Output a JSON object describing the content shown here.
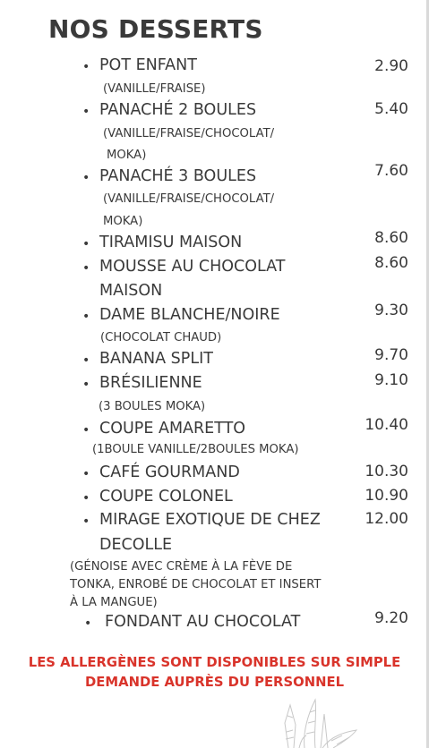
{
  "menu": {
    "title": "NOS DESSERTS",
    "bullet": "•",
    "items": [
      {
        "name": "POT ENFANT",
        "price": "2.90",
        "desc": [
          "(VANILLE/FRAISE)"
        ]
      },
      {
        "name": "PANACHÉ 2 BOULES",
        "price": "5.40",
        "desc": [
          "(VANILLE/FRAISE/CHOCOLAT/",
          "MOKA)"
        ]
      },
      {
        "name": "PANACHÉ 3 BOULES",
        "price": "7.60",
        "desc": [
          "(VANILLE/FRAISE/CHOCOLAT/",
          "MOKA)"
        ]
      },
      {
        "name": "TIRAMISU MAISON",
        "price": "8.60",
        "desc": []
      },
      {
        "name": "MOUSSE AU CHOCOLAT",
        "name2": "MAISON",
        "price": "8.60",
        "desc": []
      },
      {
        "name": "DAME BLANCHE/NOIRE",
        "price": "9.30",
        "desc": [
          "(CHOCOLAT CHAUD)"
        ]
      },
      {
        "name": "BANANA SPLIT",
        "price": "9.70",
        "desc": []
      },
      {
        "name": "BRÉSILIENNE",
        "price": "9.10",
        "desc": [
          "(3 BOULES MOKA)"
        ]
      },
      {
        "name": "COUPE AMARETTO",
        "price": "10.40",
        "desc": [
          "(1BOULE VANILLE/2BOULES MOKA)"
        ]
      },
      {
        "name": "CAFÉ GOURMAND",
        "price": "10.30",
        "desc": []
      },
      {
        "name": "COUPE COLONEL",
        "price": "10.90",
        "desc": []
      },
      {
        "name": "MIRAGE EXOTIQUE DE CHEZ",
        "name2": "DECOLLE",
        "price": "12.00",
        "desc": [
          "(GÉNOISE AVEC CRÈME À LA FÈVE DE",
          "TONKA, ENROBÉ DE CHOCOLAT ET INSERT",
          "À LA MANGUE)"
        ]
      },
      {
        "name": "FONDANT AU CHOCOLAT",
        "price": "9.20",
        "desc": []
      }
    ]
  },
  "allergen_notice": {
    "line1": "LES ALLERGÈNES SONT DISPONIBLES SUR SIMPLE",
    "line2": "DEMANDE AUPRÈS DU PERSONNEL"
  },
  "colors": {
    "text": "#3a3a3a",
    "notice": "#d9342b"
  },
  "decoration": "ice-cream-sketch-icon"
}
